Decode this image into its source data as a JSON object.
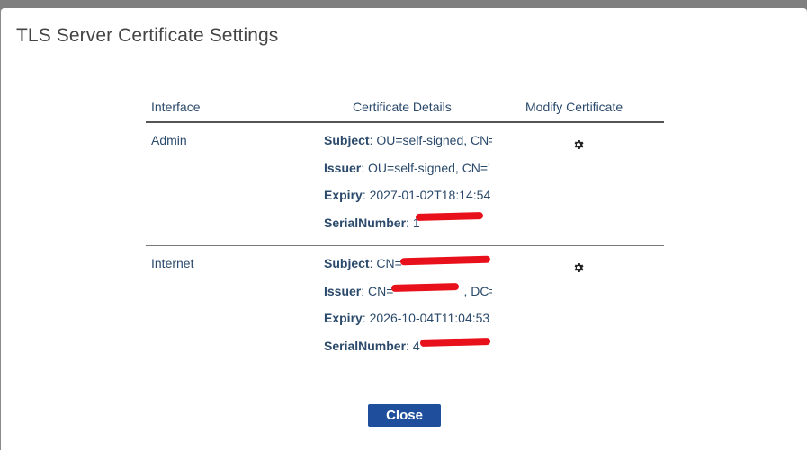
{
  "dialog": {
    "title": "TLS Server Certificate Settings"
  },
  "table": {
    "headers": {
      "interface": "Interface",
      "details": "Certificate Details",
      "modify": "Modify Certificate"
    },
    "rows": [
      {
        "interface": "Admin",
        "subject_label": "Subject",
        "subject_value": ": OU=self-signed, CN=",
        "issuer_label": "Issuer",
        "issuer_value": ": OU=self-signed, CN='",
        "expiry_label": "Expiry",
        "expiry_value": ": 2027-01-02T18:14:54",
        "serial_label": "SerialNumber",
        "serial_value": ": 1"
      },
      {
        "interface": "Internet",
        "subject_label": "Subject",
        "subject_value": ": CN=",
        "issuer_label": "Issuer",
        "issuer_value": ": CN=",
        "issuer_suffix": ", DC=!",
        "expiry_label": "Expiry",
        "expiry_value": ": 2026-10-04T11:04:53",
        "serial_label": "SerialNumber",
        "serial_value": ": 4"
      }
    ]
  },
  "footer": {
    "close_label": "Close"
  },
  "colors": {
    "accent": "#1f4f9c",
    "text": "#2b4a6b",
    "redaction": "#e8101a"
  },
  "icons": {
    "modify": "gear-icon"
  }
}
